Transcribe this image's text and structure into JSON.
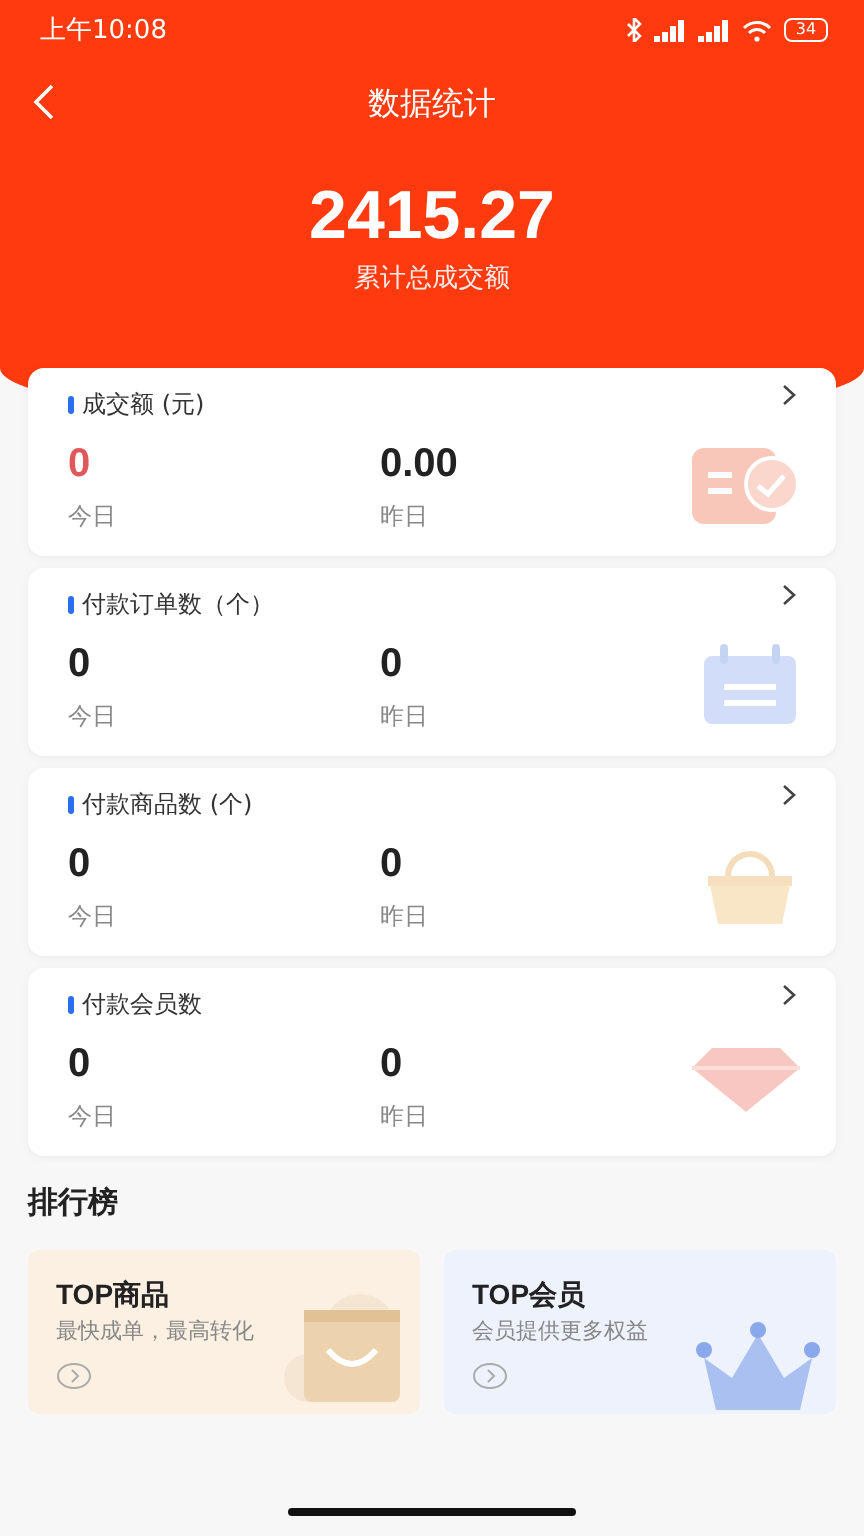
{
  "status_bar": {
    "time": "上午10:08",
    "battery": "34"
  },
  "nav": {
    "title": "数据统计"
  },
  "summary": {
    "value": "2415.27",
    "label": "累计总成交额"
  },
  "stat_cards": [
    {
      "kind": "amount",
      "title": "成交额 (元)",
      "today_value": "0",
      "today_label": "今日",
      "yesterday_value": "0.00",
      "yesterday_label": "昨日",
      "highlighted": true
    },
    {
      "kind": "orders",
      "title": "付款订单数（个）",
      "today_value": "0",
      "today_label": "今日",
      "yesterday_value": "0",
      "yesterday_label": "昨日",
      "highlighted": false
    },
    {
      "kind": "goods",
      "title": "付款商品数 (个)",
      "today_value": "0",
      "today_label": "今日",
      "yesterday_value": "0",
      "yesterday_label": "昨日",
      "highlighted": false
    },
    {
      "kind": "members",
      "title": "付款会员数",
      "today_value": "0",
      "today_label": "今日",
      "yesterday_value": "0",
      "yesterday_label": "昨日",
      "highlighted": false
    }
  ],
  "ranking": {
    "title": "排行榜",
    "cards": [
      {
        "kind": "goods",
        "title": "TOP商品",
        "subtitle": "最快成单，最高转化"
      },
      {
        "kind": "members",
        "title": "TOP会员",
        "subtitle": "会员提供更多权益"
      }
    ]
  }
}
